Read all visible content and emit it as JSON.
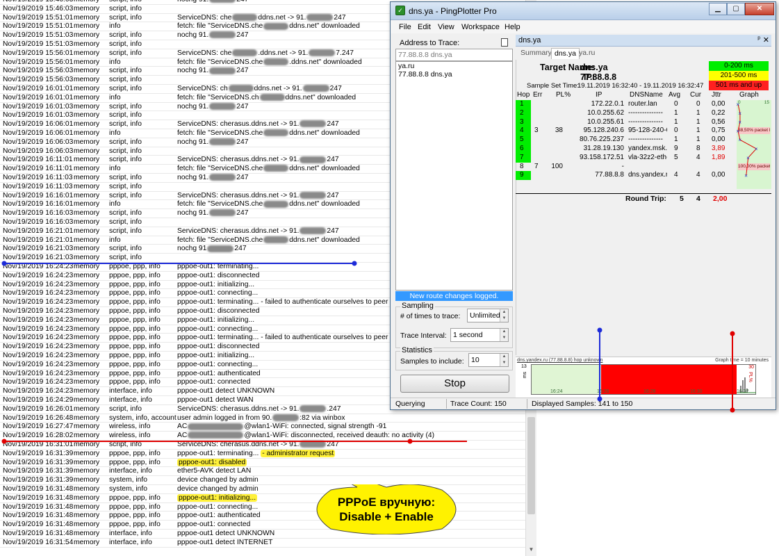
{
  "log": {
    "rows": [
      {
        "date": "Nov/19/2019 15:46:03",
        "buf": "memory",
        "topic": "script, info",
        "msg": "nochg 91.",
        "tail": "247"
      },
      {
        "date": "Nov/19/2019 15:46:03",
        "buf": "memory",
        "topic": "script, info",
        "msg": ""
      },
      {
        "date": "Nov/19/2019 15:51:01",
        "buf": "memory",
        "topic": "script, info",
        "msg": "ServiceDNS: che",
        "mid": "ddns.net -> 91.",
        "tail": "247"
      },
      {
        "date": "Nov/19/2019 15:51:01",
        "buf": "memory",
        "topic": "info",
        "msg": "fetch: file \"ServiceDNS.che",
        "mid": "ddns.net\" downloaded"
      },
      {
        "date": "Nov/19/2019 15:51:03",
        "buf": "memory",
        "topic": "script, info",
        "msg": "nochg 91.",
        "tail": "247"
      },
      {
        "date": "Nov/19/2019 15:51:03",
        "buf": "memory",
        "topic": "script, info",
        "msg": ""
      },
      {
        "date": "Nov/19/2019 15:56:01",
        "buf": "memory",
        "topic": "script, info",
        "msg": "ServiceDNS: che",
        "mid": ".ddns.net -> 91.",
        "tail": "7.247"
      },
      {
        "date": "Nov/19/2019 15:56:01",
        "buf": "memory",
        "topic": "info",
        "msg": "fetch: file \"ServiceDNS.che",
        "mid": ".ddns.net\" downloaded"
      },
      {
        "date": "Nov/19/2019 15:56:03",
        "buf": "memory",
        "topic": "script, info",
        "msg": "nochg 91.",
        "tail": "247"
      },
      {
        "date": "Nov/19/2019 15:56:03",
        "buf": "memory",
        "topic": "script, info",
        "msg": ""
      },
      {
        "date": "Nov/19/2019 16:01:01",
        "buf": "memory",
        "topic": "script, info",
        "msg": "ServiceDNS: ch",
        "mid": "ddns.net -> 91.",
        "tail": "247"
      },
      {
        "date": "Nov/19/2019 16:01:01",
        "buf": "memory",
        "topic": "info",
        "msg": "fetch: file \"ServiceDNS.ch",
        "mid": "ddns.net\" downloaded"
      },
      {
        "date": "Nov/19/2019 16:01:03",
        "buf": "memory",
        "topic": "script, info",
        "msg": "nochg 91.",
        "tail": "247"
      },
      {
        "date": "Nov/19/2019 16:01:03",
        "buf": "memory",
        "topic": "script, info",
        "msg": ""
      },
      {
        "date": "Nov/19/2019 16:06:01",
        "buf": "memory",
        "topic": "script, info",
        "msg": "ServiceDNS: cherasus.ddns.net -> 91.",
        "tail": "247"
      },
      {
        "date": "Nov/19/2019 16:06:01",
        "buf": "memory",
        "topic": "info",
        "msg": "fetch: file \"ServiceDNS.che",
        "mid": "ddns.net\" downloaded"
      },
      {
        "date": "Nov/19/2019 16:06:03",
        "buf": "memory",
        "topic": "script, info",
        "msg": "nochg 91.",
        "tail": "247"
      },
      {
        "date": "Nov/19/2019 16:06:03",
        "buf": "memory",
        "topic": "script, info",
        "msg": ""
      },
      {
        "date": "Nov/19/2019 16:11:01",
        "buf": "memory",
        "topic": "script, info",
        "msg": "ServiceDNS: cherasus.ddns.net -> 91.",
        "tail": "247"
      },
      {
        "date": "Nov/19/2019 16:11:01",
        "buf": "memory",
        "topic": "info",
        "msg": "fetch: file \"ServiceDNS.che",
        "mid": "ddns.net\" downloaded"
      },
      {
        "date": "Nov/19/2019 16:11:03",
        "buf": "memory",
        "topic": "script, info",
        "msg": "nochg 91.",
        "tail": "247"
      },
      {
        "date": "Nov/19/2019 16:11:03",
        "buf": "memory",
        "topic": "script, info",
        "msg": ""
      },
      {
        "date": "Nov/19/2019 16:16:01",
        "buf": "memory",
        "topic": "script, info",
        "msg": "ServiceDNS: cherasus.ddns.net -> 91.",
        "tail": "247"
      },
      {
        "date": "Nov/19/2019 16:16:01",
        "buf": "memory",
        "topic": "info",
        "msg": "fetch: file \"ServiceDNS.che",
        "mid": "ddns.net\" downloaded"
      },
      {
        "date": "Nov/19/2019 16:16:03",
        "buf": "memory",
        "topic": "script, info",
        "msg": "nochg 91.",
        "tail": "247"
      },
      {
        "date": "Nov/19/2019 16:16:03",
        "buf": "memory",
        "topic": "script, info",
        "msg": ""
      },
      {
        "date": "Nov/19/2019 16:21:01",
        "buf": "memory",
        "topic": "script, info",
        "msg": "ServiceDNS: cherasus.ddns.net -> 91.",
        "tail": "247"
      },
      {
        "date": "Nov/19/2019 16:21:01",
        "buf": "memory",
        "topic": "info",
        "msg": "fetch: file \"ServiceDNS.che",
        "mid": "ddns.net\" downloaded"
      },
      {
        "date": "Nov/19/2019 16:21:03",
        "buf": "memory",
        "topic": "script, info",
        "msg": "nochg 91",
        "tail": "247"
      },
      {
        "date": "Nov/19/2019 16:21:03",
        "buf": "memory",
        "topic": "script, info",
        "msg": ""
      },
      {
        "date": "Nov/19/2019 16:24:23",
        "buf": "memory",
        "topic": "pppoe, ppp, info",
        "msg": "pppoe-out1: terminating..."
      },
      {
        "date": "Nov/19/2019 16:24:23",
        "buf": "memory",
        "topic": "pppoe, ppp, info",
        "msg": "pppoe-out1: disconnected"
      },
      {
        "date": "Nov/19/2019 16:24:23",
        "buf": "memory",
        "topic": "pppoe, ppp, info",
        "msg": "pppoe-out1: initializing..."
      },
      {
        "date": "Nov/19/2019 16:24:23",
        "buf": "memory",
        "topic": "pppoe, ppp, info",
        "msg": "pppoe-out1: connecting..."
      },
      {
        "date": "Nov/19/2019 16:24:23",
        "buf": "memory",
        "topic": "pppoe, ppp, info",
        "msg": "pppoe-out1: terminating... - failed to authenticate ourselves to peer"
      },
      {
        "date": "Nov/19/2019 16:24:23",
        "buf": "memory",
        "topic": "pppoe, ppp, info",
        "msg": "pppoe-out1: disconnected"
      },
      {
        "date": "Nov/19/2019 16:24:23",
        "buf": "memory",
        "topic": "pppoe, ppp, info",
        "msg": "pppoe-out1: initializing..."
      },
      {
        "date": "Nov/19/2019 16:24:23",
        "buf": "memory",
        "topic": "pppoe, ppp, info",
        "msg": "pppoe-out1: connecting..."
      },
      {
        "date": "Nov/19/2019 16:24:23",
        "buf": "memory",
        "topic": "pppoe, ppp, info",
        "msg": "pppoe-out1: terminating... - failed to authenticate ourselves to peer"
      },
      {
        "date": "Nov/19/2019 16:24:23",
        "buf": "memory",
        "topic": "pppoe, ppp, info",
        "msg": "pppoe-out1: disconnected"
      },
      {
        "date": "Nov/19/2019 16:24:23",
        "buf": "memory",
        "topic": "pppoe, ppp, info",
        "msg": "pppoe-out1: initializing..."
      },
      {
        "date": "Nov/19/2019 16:24:23",
        "buf": "memory",
        "topic": "pppoe, ppp, info",
        "msg": "pppoe-out1: connecting..."
      },
      {
        "date": "Nov/19/2019 16:24:23",
        "buf": "memory",
        "topic": "pppoe, ppp, info",
        "msg": "pppoe-out1: authenticated"
      },
      {
        "date": "Nov/19/2019 16:24:23",
        "buf": "memory",
        "topic": "pppoe, ppp, info",
        "msg": "pppoe-out1: connected"
      },
      {
        "date": "Nov/19/2019 16:24:23",
        "buf": "memory",
        "topic": "interface, info",
        "msg": "pppoe-out1 detect UNKNOWN"
      },
      {
        "date": "Nov/19/2019 16:24:29",
        "buf": "memory",
        "topic": "interface, info",
        "msg": "pppoe-out1 detect WAN"
      },
      {
        "date": "Nov/19/2019 16:26:01",
        "buf": "memory",
        "topic": "script, info",
        "msg": "ServiceDNS: cherasus.ddns.net -> 91.",
        "tail": ".247"
      },
      {
        "date": "Nov/19/2019 16:26:48",
        "buf": "memory",
        "topic": "system, info, account",
        "msg": "user admin logged in from 90.",
        "tail": ":82 via winbox"
      },
      {
        "date": "Nov/19/2019 16:27:47",
        "buf": "memory",
        "topic": "wireless, info",
        "msg": "AC",
        "tail": "@wlan1-WiFi: connected, signal strength -91"
      },
      {
        "date": "Nov/19/2019 16:28:02",
        "buf": "memory",
        "topic": "wireless, info",
        "msg": "AC",
        "tail": "@wlan1-WiFi: disconnected, received deauth: no activity (4)"
      },
      {
        "date": "Nov/19/2019 16:31:01",
        "buf": "memory",
        "topic": "script, info",
        "msg": "ServiceDNS: cherasus.ddns.net -> 91.",
        "tail": "247"
      },
      {
        "date": "Nov/19/2019 16:31:39",
        "buf": "memory",
        "topic": "pppoe, ppp, info",
        "msg": "pppoe-out1: terminating... ",
        "hl": "- administrator request"
      },
      {
        "date": "Nov/19/2019 16:31:39",
        "buf": "memory",
        "topic": "pppoe, ppp, info",
        "msg": "",
        "hl": "pppoe-out1: disabled"
      },
      {
        "date": "Nov/19/2019 16:31:39",
        "buf": "memory",
        "topic": "interface, info",
        "msg": "ether5-AVK detect LAN"
      },
      {
        "date": "Nov/19/2019 16:31:39",
        "buf": "memory",
        "topic": "system, info",
        "msg": "device changed by admin"
      },
      {
        "date": "Nov/19/2019 16:31:48",
        "buf": "memory",
        "topic": "system, info",
        "msg": "device changed by admin"
      },
      {
        "date": "Nov/19/2019 16:31:48",
        "buf": "memory",
        "topic": "pppoe, ppp, info",
        "msg": "",
        "hl": "pppoe-out1: initializing..."
      },
      {
        "date": "Nov/19/2019 16:31:48",
        "buf": "memory",
        "topic": "pppoe, ppp, info",
        "msg": "pppoe-out1: connecting..."
      },
      {
        "date": "Nov/19/2019 16:31:48",
        "buf": "memory",
        "topic": "pppoe, ppp, info",
        "msg": "pppoe-out1: authenticated"
      },
      {
        "date": "Nov/19/2019 16:31:48",
        "buf": "memory",
        "topic": "pppoe, ppp, info",
        "msg": "pppoe-out1: connected"
      },
      {
        "date": "Nov/19/2019 16:31:48",
        "buf": "memory",
        "topic": "interface, info",
        "msg": "pppoe-out1 detect UNKNOWN"
      },
      {
        "date": "Nov/19/2019 16:31:54",
        "buf": "memory",
        "topic": "interface, info",
        "msg": "pppoe-out1 detect INTERNET"
      }
    ]
  },
  "callout": {
    "line1": "PPPoE вручную:",
    "line2": "Disable + Enable"
  },
  "window": {
    "title": "dns.ya - PingPlotter Pro",
    "menu": [
      "File",
      "Edit",
      "View",
      "Workspace",
      "Help"
    ],
    "address_label": "Address to Trace:",
    "address_value": "77.88.8.8 dns.ya",
    "targets": [
      "ya.ru",
      "77.88.8.8 dns.ya"
    ],
    "route_msg": "New route changes logged.",
    "sampling": {
      "group": "Sampling",
      "times_label": "# of times to trace:",
      "times_value": "Unlimited",
      "interval_label": "Trace Interval:",
      "interval_value": "1 second"
    },
    "statistics": {
      "group": "Statistics",
      "samples_label": "Samples to include:",
      "samples_value": "10"
    },
    "stop_label": "Stop",
    "doc_title": "dns.ya",
    "pin": "ᵖ",
    "close": "✕",
    "tabs": [
      "Summary",
      "dns.ya",
      "ya.ru"
    ],
    "header": {
      "target_label": "Target Name:",
      "target_value": "dns.ya",
      "ip_label": "IP:",
      "ip_value": "77.88.8.8",
      "sst_label": "Sample Set Time:",
      "sst_value": "19.11.2019 16:32:40 - 19.11.2019 16:32:47"
    },
    "legend": [
      {
        "label": "0-200 ms",
        "color": "#00ee00"
      },
      {
        "label": "201-500 ms",
        "color": "#ffff00"
      },
      {
        "label": "501 ms and up",
        "color": "#ff2020"
      }
    ],
    "columns": [
      "Hop",
      "Err",
      "PL%",
      "IP",
      "DNSName",
      "Avg",
      "Cur",
      "Jttr",
      "Graph"
    ],
    "graph_scale": {
      "min": "0",
      "max": "15"
    },
    "hops": [
      {
        "hop": "1",
        "err": "",
        "pl": "",
        "ip": "172.22.0.1",
        "dns": "router.lan",
        "avg": "0",
        "cur": "0",
        "jttr": "0,00",
        "green": true,
        "red": false
      },
      {
        "hop": "2",
        "err": "",
        "pl": "",
        "ip": "10.0.255.62",
        "dns": "---------------",
        "avg": "1",
        "cur": "1",
        "jttr": "0,22",
        "green": true,
        "red": false
      },
      {
        "hop": "3",
        "err": "",
        "pl": "",
        "ip": "10.0.255.61",
        "dns": "---------------",
        "avg": "1",
        "cur": "1",
        "jttr": "0,56",
        "green": true,
        "red": false
      },
      {
        "hop": "4",
        "err": "3",
        "pl": "38",
        "ip": "95.128.240.6",
        "dns": "95-128-240-6",
        "avg": "0",
        "cur": "1",
        "jttr": "0,75",
        "green": true,
        "red": false,
        "loss": "38,50% packet loss"
      },
      {
        "hop": "5",
        "err": "",
        "pl": "",
        "ip": "80.76.225.237",
        "dns": "---------------",
        "avg": "1",
        "cur": "1",
        "jttr": "0,00",
        "green": true,
        "red": false
      },
      {
        "hop": "6",
        "err": "",
        "pl": "",
        "ip": "31.28.19.130",
        "dns": "yandex.msk.c",
        "avg": "9",
        "cur": "8",
        "jttr": "3,89",
        "green": true,
        "red": true
      },
      {
        "hop": "7",
        "err": "",
        "pl": "",
        "ip": "93.158.172.51",
        "dns": "vla-32z2-eth-",
        "avg": "5",
        "cur": "4",
        "jttr": "1,89",
        "green": true,
        "red": true
      },
      {
        "hop": "8",
        "err": "7",
        "pl": "100",
        "ip": "-",
        "dns": "",
        "avg": "",
        "cur": "",
        "jttr": "",
        "green": false,
        "red": false,
        "loss": "100,00% packet loss"
      },
      {
        "hop": "9",
        "err": "",
        "pl": "",
        "ip": "77.88.8.8",
        "dns": "dns.yandex.r",
        "avg": "4",
        "cur": "4",
        "jttr": "0,00",
        "green": true,
        "red": false
      }
    ],
    "round_trip": {
      "label": "Round Trip:",
      "avg": "5",
      "cur": "4",
      "jttr": "2,00"
    },
    "timeline": {
      "caption": "dns.yandex.ru (77.88.8.8) hop unknown",
      "right_caption": "Graph time = 10 minutes",
      "y_max": "13",
      "y_unit": "ms",
      "pl_max": "30",
      "pl_unit": "PL%",
      "ticks": [
        "16:24",
        "16:26",
        "16:28",
        "16:30",
        "16:32"
      ]
    },
    "status": {
      "state": "Querying",
      "trace_count": "Trace Count: 150",
      "displayed": "Displayed Samples: 141 to 150"
    }
  }
}
